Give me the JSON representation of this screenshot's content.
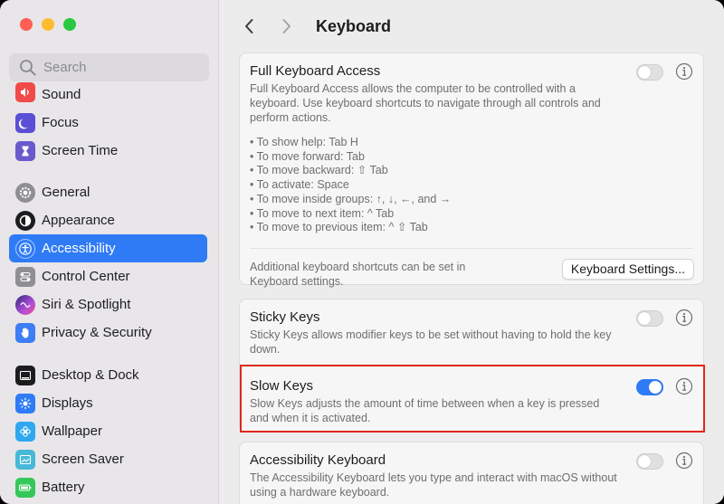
{
  "sidebar": {
    "search_placeholder": "Search",
    "items": [
      {
        "label": "Sound",
        "color": "#f04a4a"
      },
      {
        "label": "Focus",
        "color": "#5b4fd6"
      },
      {
        "label": "Screen Time",
        "color": "#6a5acd"
      },
      {
        "label": "General",
        "color": "#8e8e93"
      },
      {
        "label": "Appearance",
        "color": "#1c1c1e"
      },
      {
        "label": "Accessibility",
        "color": "#2f7bf6"
      },
      {
        "label": "Control Center",
        "color": "#8e8e93"
      },
      {
        "label": "Siri & Spotlight",
        "color": "#b04ed8"
      },
      {
        "label": "Privacy & Security",
        "color": "#3d7df5"
      },
      {
        "label": "Desktop & Dock",
        "color": "#1c1c1e"
      },
      {
        "label": "Displays",
        "color": "#2f7bf6"
      },
      {
        "label": "Wallpaper",
        "color": "#2fa8f0"
      },
      {
        "label": "Screen Saver",
        "color": "#47b8d8"
      },
      {
        "label": "Battery",
        "color": "#34c759"
      }
    ],
    "active": "Accessibility"
  },
  "header": {
    "title": "Keyboard"
  },
  "full_keyboard_access": {
    "title": "Full Keyboard Access",
    "description": "Full Keyboard Access allows the computer to be controlled with a keyboard. Use keyboard shortcuts to navigate through all controls and perform actions.",
    "bullets": [
      "• To show help: Tab H",
      "• To move forward: Tab",
      "• To move backward: ⇧ Tab",
      "• To activate: Space",
      "• To move inside groups: ↑, ↓, ←, and →",
      "• To move to next item: ^ Tab",
      "• To move to previous item: ^ ⇧ Tab"
    ],
    "enabled": false,
    "additional_text": "Additional keyboard shortcuts can be set in Keyboard settings.",
    "settings_button": "Keyboard Settings..."
  },
  "sticky_keys": {
    "title": "Sticky Keys",
    "description": "Sticky Keys allows modifier keys to be set without having to hold the key down.",
    "enabled": false
  },
  "slow_keys": {
    "title": "Slow Keys",
    "description": "Slow Keys adjusts the amount of time between when a key is pressed and when it is activated.",
    "enabled": true
  },
  "accessibility_keyboard": {
    "title": "Accessibility Keyboard",
    "description": "The Accessibility Keyboard lets you type and interact with macOS without using a hardware keyboard.",
    "enabled": false
  },
  "colors": {
    "accent": "#2f7bf6",
    "highlight": "#e0281c"
  }
}
